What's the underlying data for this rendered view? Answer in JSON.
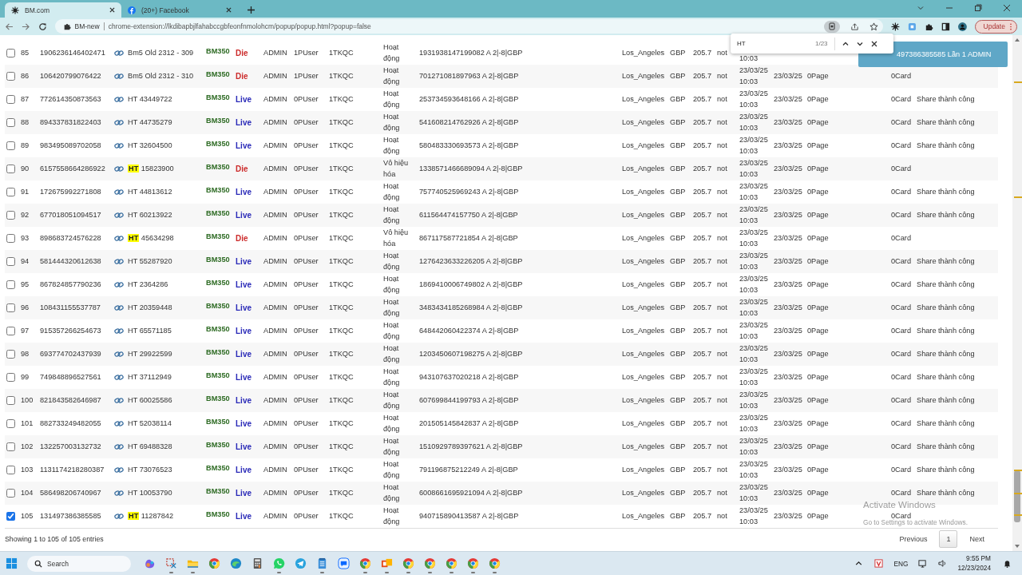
{
  "browser": {
    "tabs": [
      {
        "title": "BM.com",
        "selected": true
      },
      {
        "title": "(20+) Facebook",
        "selected": false
      }
    ],
    "site_label": "BM-new",
    "url": "chrome-extension://lkdibapbjlfahabccgbfeonfnmolohcm/popup/popup.html?popup=false",
    "update_button": "Update"
  },
  "find_bar": {
    "value": "HT",
    "count": "1/23"
  },
  "toast": {
    "text": "497386385585 Lần 1 ADMIN"
  },
  "table": {
    "rows": [
      {
        "number": "85",
        "checked": false,
        "id": "1906236146402471",
        "name": "Bm5 Old 2312 - 309",
        "bm": "BM350",
        "status": "Die",
        "color": "#cc2b2b",
        "role": "ADMIN",
        "users": "1PUser",
        "ads": "1TKQC",
        "state": "Hoạt động",
        "account": "1931938147199082 A 2|-8|GBP",
        "city": "Los_Angeles",
        "currency": "GBP",
        "amount": "205.7",
        "flag": "not",
        "created_time": "10:03"
      },
      {
        "number": "86",
        "checked": false,
        "id": "106420799076422",
        "name": "Bm5 Old 2312 - 310",
        "bm": "BM350",
        "status": "Die",
        "color": "#cc2b2b",
        "role": "ADMIN",
        "users": "1PUser",
        "ads": "1TKQC",
        "state": "Hoạt động",
        "account": "701271081897963 A 2|-8|GBP",
        "city": "Los_Angeles",
        "currency": "GBP",
        "amount": "205.7",
        "flag": "not",
        "created_date": "23/03/25",
        "created_time": "10:03",
        "date": "23/03/25",
        "pages": "0Page",
        "cards": "0Card"
      },
      {
        "number": "87",
        "checked": false,
        "id": "772614350873563",
        "name": "HT 43449722",
        "bm": "BM350",
        "status": "Live",
        "color": "#2a2ab8",
        "role": "ADMIN",
        "users": "0PUser",
        "ads": "1TKQC",
        "state": "Hoạt động",
        "account": "253734593648166 A 2|-8|GBP",
        "city": "Los_Angeles",
        "currency": "GBP",
        "amount": "205.7",
        "flag": "not",
        "created_date": "23/03/25",
        "created_time": "10:03",
        "date": "23/03/25",
        "pages": "0Page",
        "cards": "0Card",
        "share": "Share thành công"
      },
      {
        "number": "88",
        "checked": false,
        "id": "894337831822403",
        "name": "HT 44735279",
        "bm": "BM350",
        "status": "Live",
        "color": "#2a2ab8",
        "role": "ADMIN",
        "users": "0PUser",
        "ads": "1TKQC",
        "state": "Hoạt động",
        "account": "541608214762926 A 2|-8|GBP",
        "city": "Los_Angeles",
        "currency": "GBP",
        "amount": "205.7",
        "flag": "not",
        "created_date": "23/03/25",
        "created_time": "10:03",
        "date": "23/03/25",
        "pages": "0Page",
        "cards": "0Card",
        "share": "Share thành công"
      },
      {
        "number": "89",
        "checked": false,
        "id": "983495089702058",
        "name": "HT 32604500",
        "bm": "BM350",
        "status": "Live",
        "color": "#2a2ab8",
        "role": "ADMIN",
        "users": "0PUser",
        "ads": "1TKQC",
        "state": "Hoạt động",
        "account": "580483330693573 A 2|-8|GBP",
        "city": "Los_Angeles",
        "currency": "GBP",
        "amount": "205.7",
        "flag": "not",
        "created_date": "23/03/25",
        "created_time": "10:03",
        "date": "23/03/25",
        "pages": "0Page",
        "cards": "0Card",
        "share": "Share thành công"
      },
      {
        "number": "90",
        "checked": false,
        "id": "6157558664286922",
        "match": "HT",
        "name": "15823900",
        "bm": "BM350",
        "status": "Die",
        "color": "#cc2b2b",
        "role": "ADMIN",
        "users": "0PUser",
        "ads": "1TKQC",
        "state": "Vô hiệu hóa",
        "account": "1338571466689094 A 2|-8|GBP",
        "city": "Los_Angeles",
        "currency": "GBP",
        "amount": "205.7",
        "flag": "not",
        "created_date": "23/03/25",
        "created_time": "10:03",
        "date": "23/03/25",
        "pages": "0Page",
        "cards": "0Card"
      },
      {
        "number": "91",
        "checked": false,
        "id": "172675992271808",
        "name": "HT 44813612",
        "bm": "BM350",
        "status": "Live",
        "color": "#2a2ab8",
        "role": "ADMIN",
        "users": "0PUser",
        "ads": "1TKQC",
        "state": "Hoạt động",
        "account": "757740525969243 A 2|-8|GBP",
        "city": "Los_Angeles",
        "currency": "GBP",
        "amount": "205.7",
        "flag": "not",
        "created_date": "23/03/25",
        "created_time": "10:03",
        "date": "23/03/25",
        "pages": "0Page",
        "cards": "0Card",
        "share": "Share thành công"
      },
      {
        "number": "92",
        "checked": false,
        "id": "677018051094517",
        "name": "HT 60213922",
        "bm": "BM350",
        "status": "Live",
        "color": "#2a2ab8",
        "role": "ADMIN",
        "users": "0PUser",
        "ads": "1TKQC",
        "state": "Hoạt động",
        "account": "611564474157750 A 2|-8|GBP",
        "city": "Los_Angeles",
        "currency": "GBP",
        "amount": "205.7",
        "flag": "not",
        "created_date": "23/03/25",
        "created_time": "10:03",
        "date": "23/03/25",
        "pages": "0Page",
        "cards": "0Card",
        "share": "Share thành công"
      },
      {
        "number": "93",
        "checked": false,
        "id": "898683724576228",
        "match": "HT",
        "name": "45634298",
        "bm": "BM350",
        "status": "Die",
        "color": "#cc2b2b",
        "role": "ADMIN",
        "users": "0PUser",
        "ads": "1TKQC",
        "state": "Vô hiệu hóa",
        "account": "867117587721854 A 2|-8|GBP",
        "city": "Los_Angeles",
        "currency": "GBP",
        "amount": "205.7",
        "flag": "not",
        "created_date": "23/03/25",
        "created_time": "10:03",
        "date": "23/03/25",
        "pages": "0Page",
        "cards": "0Card"
      },
      {
        "number": "94",
        "checked": false,
        "id": "581444320612638",
        "name": "HT 55287920",
        "bm": "BM350",
        "status": "Live",
        "color": "#2a2ab8",
        "role": "ADMIN",
        "users": "0PUser",
        "ads": "1TKQC",
        "state": "Hoạt động",
        "account": "1276423633226205 A 2|-8|GBP",
        "city": "Los_Angeles",
        "currency": "GBP",
        "amount": "205.7",
        "flag": "not",
        "created_date": "23/03/25",
        "created_time": "10:03",
        "date": "23/03/25",
        "pages": "0Page",
        "cards": "0Card",
        "share": "Share thành công"
      },
      {
        "number": "95",
        "checked": false,
        "id": "867824857790236",
        "name": "HT 2364286",
        "bm": "BM350",
        "status": "Live",
        "color": "#2a2ab8",
        "role": "ADMIN",
        "users": "0PUser",
        "ads": "1TKQC",
        "state": "Hoạt động",
        "account": "1869410006749802 A 2|-8|GBP",
        "city": "Los_Angeles",
        "currency": "GBP",
        "amount": "205.7",
        "flag": "not",
        "created_date": "23/03/25",
        "created_time": "10:03",
        "date": "23/03/25",
        "pages": "0Page",
        "cards": "0Card",
        "share": "Share thành công"
      },
      {
        "number": "96",
        "checked": false,
        "id": "108431155537787",
        "name": "HT 20359448",
        "bm": "BM350",
        "status": "Live",
        "color": "#2a2ab8",
        "role": "ADMIN",
        "users": "0PUser",
        "ads": "1TKQC",
        "state": "Hoạt động",
        "account": "3483434185268984 A 2|-8|GBP",
        "city": "Los_Angeles",
        "currency": "GBP",
        "amount": "205.7",
        "flag": "not",
        "created_date": "23/03/25",
        "created_time": "10:03",
        "date": "23/03/25",
        "pages": "0Page",
        "cards": "0Card",
        "share": "Share thành công"
      },
      {
        "number": "97",
        "checked": false,
        "id": "915357266254673",
        "name": "HT 65571185",
        "bm": "BM350",
        "status": "Live",
        "color": "#2a2ab8",
        "role": "ADMIN",
        "users": "0PUser",
        "ads": "1TKQC",
        "state": "Hoạt động",
        "account": "648442060422374 A 2|-8|GBP",
        "city": "Los_Angeles",
        "currency": "GBP",
        "amount": "205.7",
        "flag": "not",
        "created_date": "23/03/25",
        "created_time": "10:03",
        "date": "23/03/25",
        "pages": "0Page",
        "cards": "0Card",
        "share": "Share thành công"
      },
      {
        "number": "98",
        "checked": false,
        "id": "693774702437939",
        "name": "HT 29922599",
        "bm": "BM350",
        "status": "Live",
        "color": "#2a2ab8",
        "role": "ADMIN",
        "users": "0PUser",
        "ads": "1TKQC",
        "state": "Hoạt động",
        "account": "1203450607198275 A 2|-8|GBP",
        "city": "Los_Angeles",
        "currency": "GBP",
        "amount": "205.7",
        "flag": "not",
        "created_date": "23/03/25",
        "created_time": "10:03",
        "date": "23/03/25",
        "pages": "0Page",
        "cards": "0Card",
        "share": "Share thành công"
      },
      {
        "number": "99",
        "checked": false,
        "id": "749848896527561",
        "name": "HT 37112949",
        "bm": "BM350",
        "status": "Live",
        "color": "#2a2ab8",
        "role": "ADMIN",
        "users": "0PUser",
        "ads": "1TKQC",
        "state": "Hoạt động",
        "account": "943107637020218 A 2|-8|GBP",
        "city": "Los_Angeles",
        "currency": "GBP",
        "amount": "205.7",
        "flag": "not",
        "created_date": "23/03/25",
        "created_time": "10:03",
        "date": "23/03/25",
        "pages": "0Page",
        "cards": "0Card",
        "share": "Share thành công"
      },
      {
        "number": "100",
        "checked": false,
        "id": "821843582646987",
        "name": "HT 60025586",
        "bm": "BM350",
        "status": "Live",
        "color": "#2a2ab8",
        "role": "ADMIN",
        "users": "0PUser",
        "ads": "1TKQC",
        "state": "Hoạt động",
        "account": "607699844199793 A 2|-8|GBP",
        "city": "Los_Angeles",
        "currency": "GBP",
        "amount": "205.7",
        "flag": "not",
        "created_date": "23/03/25",
        "created_time": "10:03",
        "date": "23/03/25",
        "pages": "0Page",
        "cards": "0Card",
        "share": "Share thành công"
      },
      {
        "number": "101",
        "checked": false,
        "id": "882733249482055",
        "name": "HT 52038114",
        "bm": "BM350",
        "status": "Live",
        "color": "#2a2ab8",
        "role": "ADMIN",
        "users": "0PUser",
        "ads": "1TKQC",
        "state": "Hoạt động",
        "account": "201505145842837 A 2|-8|GBP",
        "city": "Los_Angeles",
        "currency": "GBP",
        "amount": "205.7",
        "flag": "not",
        "created_date": "23/03/25",
        "created_time": "10:03",
        "date": "23/03/25",
        "pages": "0Page",
        "cards": "0Card",
        "share": "Share thành công"
      },
      {
        "number": "102",
        "checked": false,
        "id": "132257003132732",
        "name": "HT 69488328",
        "bm": "BM350",
        "status": "Live",
        "color": "#2a2ab8",
        "role": "ADMIN",
        "users": "0PUser",
        "ads": "1TKQC",
        "state": "Hoạt động",
        "account": "1510929789397621 A 2|-8|GBP",
        "city": "Los_Angeles",
        "currency": "GBP",
        "amount": "205.7",
        "flag": "not",
        "created_date": "23/03/25",
        "created_time": "10:03",
        "date": "23/03/25",
        "pages": "0Page",
        "cards": "0Card",
        "share": "Share thành công"
      },
      {
        "number": "103",
        "checked": false,
        "id": "1131174218280387",
        "name": "HT 73076523",
        "bm": "BM350",
        "status": "Live",
        "color": "#2a2ab8",
        "role": "ADMIN",
        "users": "0PUser",
        "ads": "1TKQC",
        "state": "Hoạt động",
        "account": "791196875212249 A 2|-8|GBP",
        "city": "Los_Angeles",
        "currency": "GBP",
        "amount": "205.7",
        "flag": "not",
        "created_date": "23/03/25",
        "created_time": "10:03",
        "date": "23/03/25",
        "pages": "0Page",
        "cards": "0Card",
        "share": "Share thành công"
      },
      {
        "number": "104",
        "checked": false,
        "id": "586498206740967",
        "name": "HT 10053790",
        "bm": "BM350",
        "status": "Live",
        "color": "#2a2ab8",
        "role": "ADMIN",
        "users": "0PUser",
        "ads": "1TKQC",
        "state": "Hoạt động",
        "account": "6008661695921094 A 2|-8|GBP",
        "city": "Los_Angeles",
        "currency": "GBP",
        "amount": "205.7",
        "flag": "not",
        "created_date": "23/03/25",
        "created_time": "10:03",
        "date": "23/03/25",
        "pages": "0Page",
        "cards": "0Card",
        "share": "Share thành công"
      },
      {
        "number": "105",
        "checked": true,
        "id": "131497386385585",
        "match": "HT",
        "name": "11287842",
        "bm": "BM350",
        "status": "Live",
        "color": "#2a2ab8",
        "role": "ADMIN",
        "users": "0PUser",
        "ads": "1TKQC",
        "state": "Hoạt động",
        "account": "940715890413587 A 2|-8|GBP",
        "city": "Los_Angeles",
        "currency": "GBP",
        "amount": "205.7",
        "flag": "not",
        "created_date": "23/03/25",
        "created_time": "10:03",
        "date": "23/03/25",
        "pages": "0Page",
        "cards": "0Card"
      }
    ]
  },
  "footer": {
    "info": "Showing 1 to 105 of 105 entries",
    "pagination": [
      {
        "label": "Previous",
        "selected": false
      },
      {
        "label": "1",
        "selected": true
      },
      {
        "label": "Next",
        "selected": false
      }
    ]
  },
  "os_notice": {
    "title": "Activate Windows",
    "text": "Go to Settings to activate Windows."
  },
  "taskbar": {
    "search_placeholder": "Search",
    "language": "ENG",
    "time": "9:55 PM",
    "date": "12/23/2024"
  }
}
